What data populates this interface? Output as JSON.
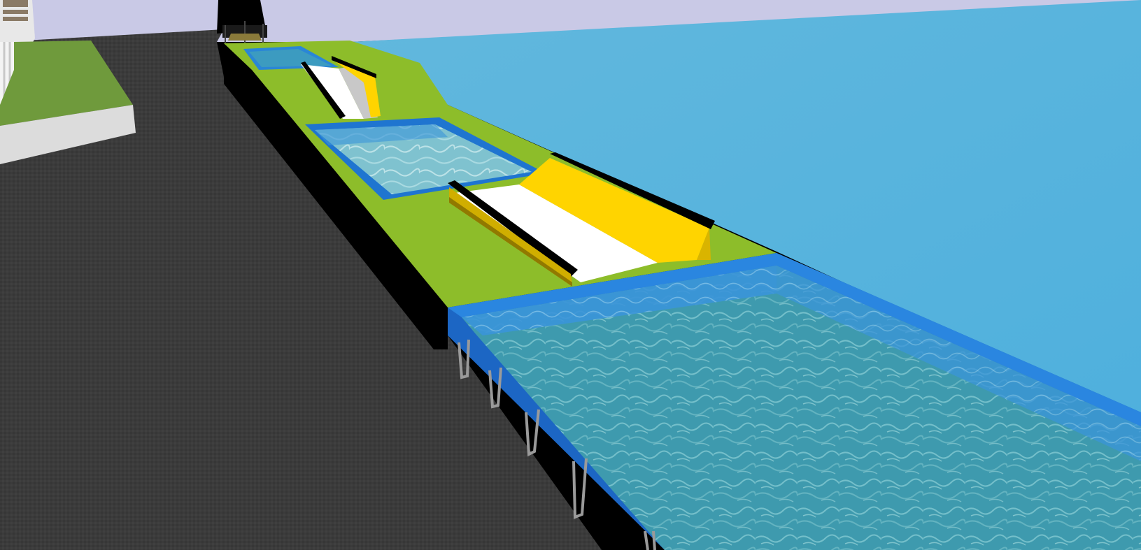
{
  "scene": {
    "description_visible_text": "",
    "colors": {
      "sky": "#c9c9e6",
      "sea_far": "#5fb6dc",
      "sea_near": "#52b3de",
      "asphalt": "#3a3a3a",
      "grass": "#8dbd2a",
      "lawn": "#6f9a3c",
      "pool_frame": "#1f6fc9",
      "pool_water": "#3f9db1",
      "slide_yellow": "#ffd400",
      "slide_white": "#ffffff",
      "platform_black": "#000000",
      "curb_white": "#e6e6e6"
    },
    "icons": [
      "building",
      "crane-structure",
      "water-slide",
      "pool-ladder"
    ]
  }
}
